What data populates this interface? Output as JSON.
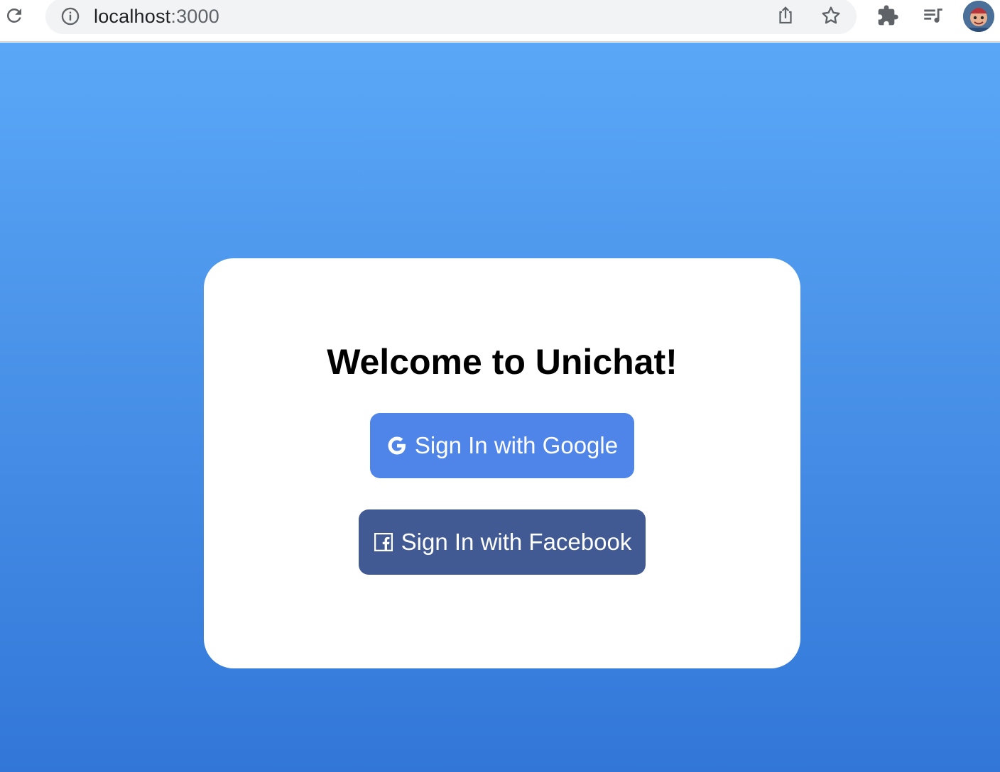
{
  "browser": {
    "url_host": "localhost",
    "url_port": ":3000"
  },
  "login": {
    "title": "Welcome to Unichat!",
    "google_label": "Sign In with Google",
    "facebook_label": "Sign In with Facebook"
  },
  "colors": {
    "google_button": "#4f84e8",
    "facebook_button": "#425a93",
    "gradient_top": "#5aa7f7",
    "gradient_bottom": "#3277d8"
  },
  "icons": {
    "reload": "reload-icon",
    "info": "info-icon",
    "share": "share-icon",
    "star": "star-icon",
    "extensions": "puzzle-icon",
    "media": "media-queue-icon",
    "google": "google-icon",
    "facebook": "facebook-icon"
  }
}
